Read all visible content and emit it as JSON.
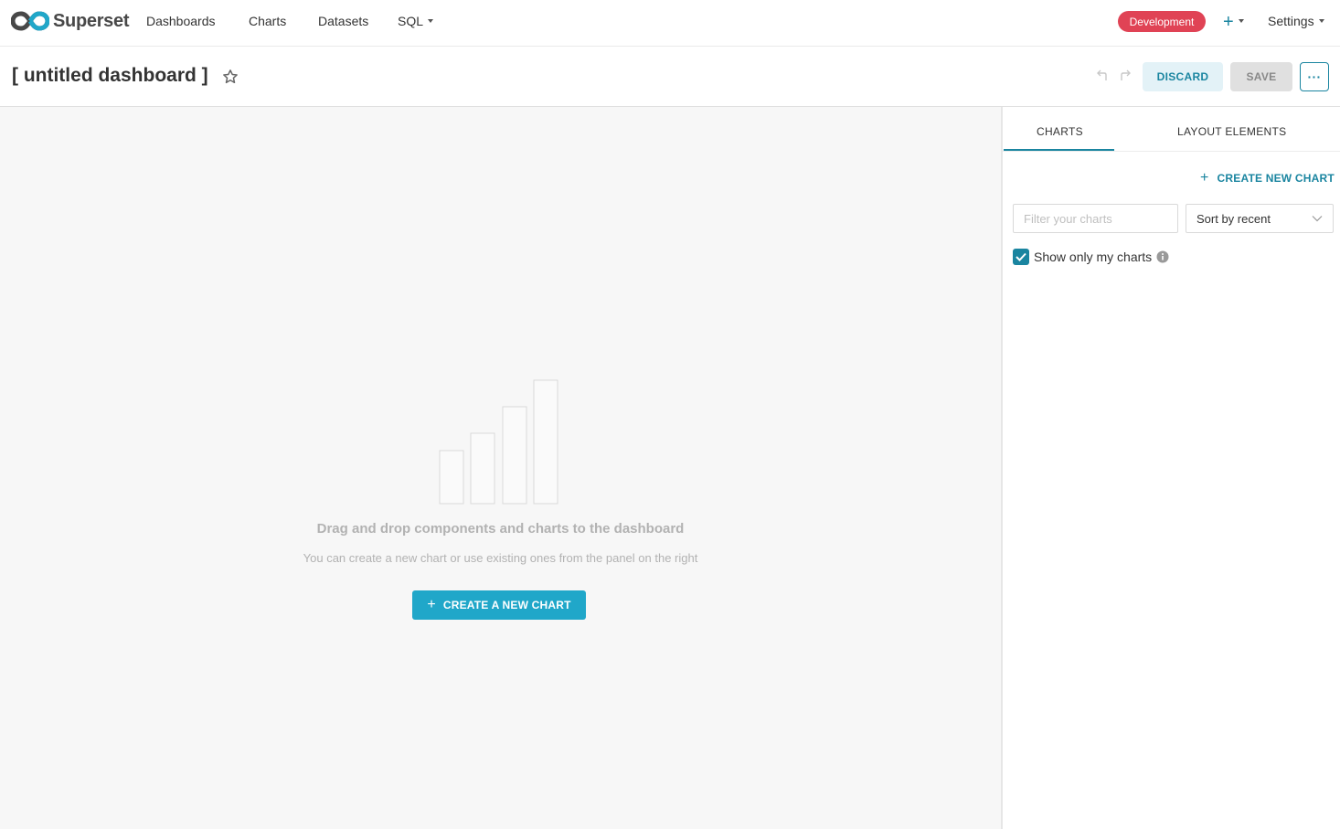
{
  "navbar": {
    "brand": "Superset",
    "items": [
      "Dashboards",
      "Charts",
      "Datasets",
      "SQL"
    ],
    "environment_badge": "Development",
    "settings_label": "Settings"
  },
  "dashboard": {
    "title": "[ untitled dashboard ]",
    "discard_label": "DISCARD",
    "save_label": "SAVE",
    "more_label": "···"
  },
  "empty_state": {
    "title": "Drag and drop components and charts to the dashboard",
    "description": "You can create a new chart or use existing ones from the panel on the right",
    "create_button": "CREATE A NEW CHART"
  },
  "panel": {
    "tabs": [
      "CHARTS",
      "LAYOUT ELEMENTS"
    ],
    "active_tab": 0,
    "create_new_chart": "CREATE NEW CHART",
    "filter_placeholder": "Filter your charts",
    "sort_value": "Sort by recent",
    "show_only_mine_label": "Show only my charts",
    "show_only_mine_checked": true
  },
  "colors": {
    "accent": "#1a85a0",
    "primary_button": "#20a7c9",
    "badge": "#e04355"
  }
}
